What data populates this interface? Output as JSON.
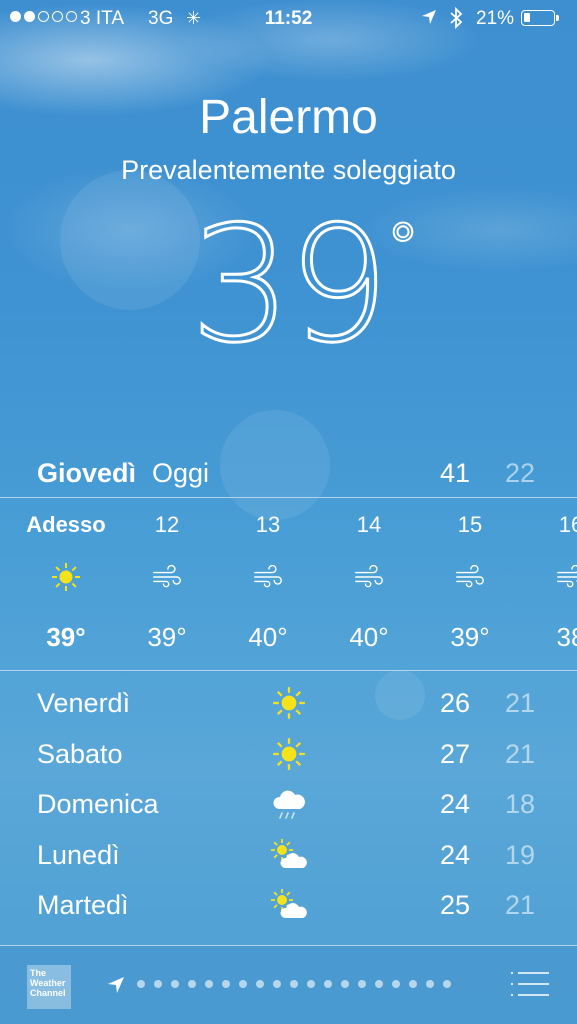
{
  "status_bar": {
    "signal_filled": 2,
    "signal_total": 5,
    "carrier": "3 ITA",
    "network": "3G",
    "time": "11:52",
    "battery_percent": "21%",
    "battery_level": 0.21
  },
  "hero": {
    "city": "Palermo",
    "condition": "Prevalentemente soleggiato",
    "temperature": "39",
    "degree": "°"
  },
  "today": {
    "day": "Giovedì",
    "label": "Oggi",
    "high": "41",
    "low": "22"
  },
  "hourly": [
    {
      "hour": "Adesso",
      "icon": "sun-icon",
      "temp": "39°"
    },
    {
      "hour": "12",
      "icon": "wind-icon",
      "temp": "39°"
    },
    {
      "hour": "13",
      "icon": "wind-icon",
      "temp": "40°"
    },
    {
      "hour": "14",
      "icon": "wind-icon",
      "temp": "40°"
    },
    {
      "hour": "15",
      "icon": "wind-icon",
      "temp": "39°"
    },
    {
      "hour": "16",
      "icon": "wind-icon",
      "temp": "38"
    }
  ],
  "daily": [
    {
      "day": "Venerdì",
      "icon": "sun-icon",
      "high": "26",
      "low": "21"
    },
    {
      "day": "Sabato",
      "icon": "sun-icon",
      "high": "27",
      "low": "21"
    },
    {
      "day": "Domenica",
      "icon": "rain-cloud-icon",
      "high": "24",
      "low": "18"
    },
    {
      "day": "Lunedì",
      "icon": "partly-cloudy-icon",
      "high": "24",
      "low": "19"
    },
    {
      "day": "Martedì",
      "icon": "partly-cloudy-icon",
      "high": "25",
      "low": "21"
    }
  ],
  "bottom_bar": {
    "logo_text": "The Weather Channel",
    "page_count": 19
  },
  "colors": {
    "sun": "#f6e21a",
    "text": "#ffffff",
    "low_temp": "rgba(255,255,255,0.55)"
  }
}
